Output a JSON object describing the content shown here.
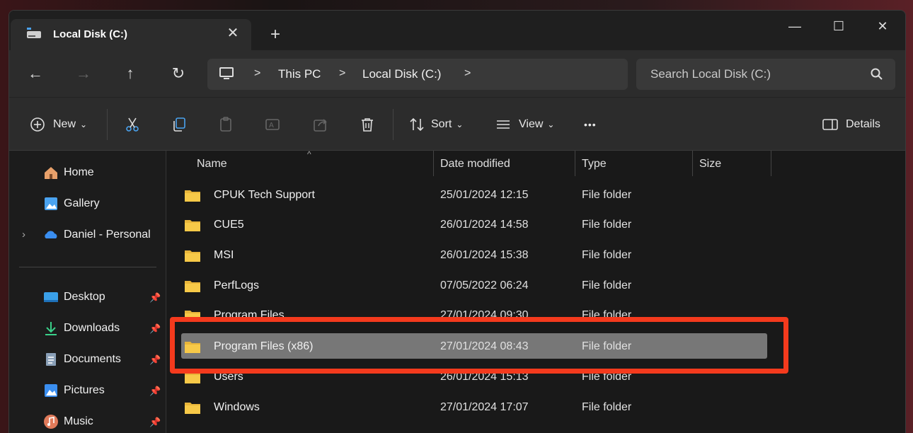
{
  "tab": {
    "title": "Local Disk (C:)",
    "close": "✕",
    "new_tab": "+"
  },
  "window_controls": {
    "minimize": "—",
    "maximize": "☐",
    "close": "✕"
  },
  "nav": {
    "back": "←",
    "forward": "→",
    "up": "↑",
    "refresh": "↻"
  },
  "address": {
    "crumbs": [
      "This PC",
      "Local Disk (C:)"
    ],
    "separator": ">"
  },
  "search": {
    "placeholder": "Search Local Disk (C:)"
  },
  "toolbar": {
    "new_label": "New",
    "sort_label": "Sort",
    "view_label": "View",
    "more_label": "•••",
    "details_label": "Details",
    "dropdown": "⌄"
  },
  "sidebar": {
    "items": [
      {
        "label": "Home",
        "icon": "home-icon"
      },
      {
        "label": "Gallery",
        "icon": "gallery-icon"
      },
      {
        "label": "Daniel - Personal",
        "icon": "onedrive-icon"
      }
    ],
    "pinned": [
      {
        "label": "Desktop",
        "icon": "desktop-icon"
      },
      {
        "label": "Downloads",
        "icon": "download-icon"
      },
      {
        "label": "Documents",
        "icon": "documents-icon"
      },
      {
        "label": "Pictures",
        "icon": "pictures-icon"
      },
      {
        "label": "Music",
        "icon": "music-icon"
      }
    ],
    "pin_glyph": "📌",
    "chevron": "›"
  },
  "columns": {
    "name": "Name",
    "date": "Date modified",
    "type": "Type",
    "size": "Size"
  },
  "files": [
    {
      "name": "CPUK Tech Support",
      "date": "25/01/2024 12:15",
      "type": "File folder"
    },
    {
      "name": "CUE5",
      "date": "26/01/2024 14:58",
      "type": "File folder"
    },
    {
      "name": "MSI",
      "date": "26/01/2024 15:38",
      "type": "File folder"
    },
    {
      "name": "PerfLogs",
      "date": "07/05/2022 06:24",
      "type": "File folder"
    },
    {
      "name": "Program Files",
      "date": "27/01/2024 09:30",
      "type": "File folder"
    },
    {
      "name": "Program Files (x86)",
      "date": "27/01/2024 08:43",
      "type": "File folder",
      "selected": true
    },
    {
      "name": "Users",
      "date": "26/01/2024 15:13",
      "type": "File folder"
    },
    {
      "name": "Windows",
      "date": "27/01/2024 17:07",
      "type": "File folder"
    }
  ],
  "colors": {
    "highlight": "#f43a1d",
    "folder": "#f7c948",
    "selected_row": "#777777"
  }
}
